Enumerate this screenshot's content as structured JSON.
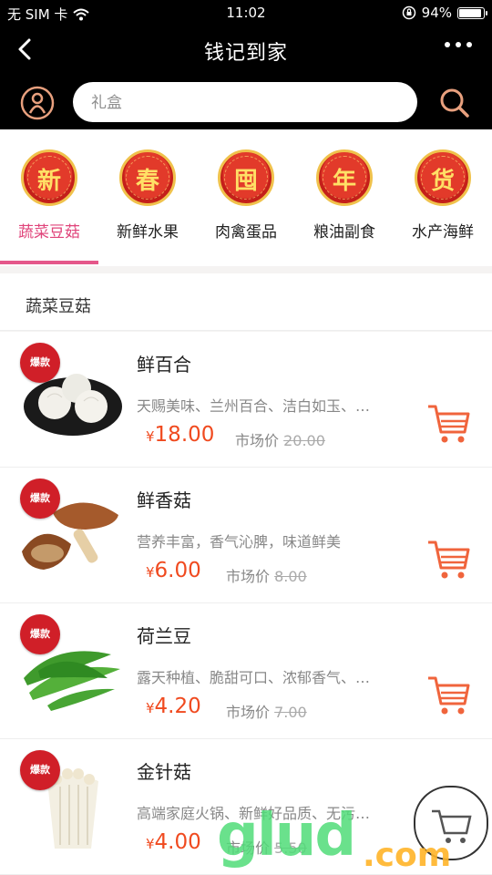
{
  "status": {
    "carrier": "无 SIM 卡",
    "time": "11:02",
    "battery": "94%",
    "battery_level": 0.94
  },
  "nav": {
    "title": "钱记到家"
  },
  "search": {
    "placeholder": "礼盒"
  },
  "categories": [
    {
      "badge": "新",
      "label": "蔬菜豆菇"
    },
    {
      "badge": "春",
      "label": "新鲜水果"
    },
    {
      "badge": "囤",
      "label": "肉禽蛋品"
    },
    {
      "badge": "年",
      "label": "粮油副食"
    },
    {
      "badge": "货",
      "label": "水产海鲜"
    }
  ],
  "section": {
    "title": "蔬菜豆菇"
  },
  "products": [
    {
      "tag": "爆款",
      "name": "鲜百合",
      "desc": "天赐美味、兰州百合、洁白如玉、…",
      "yen": "¥",
      "price": "18.00",
      "market_label": "市场价",
      "market_price": "20.00"
    },
    {
      "tag": "爆款",
      "name": "鲜香菇",
      "desc": "营养丰富，香气沁脾，味道鲜美",
      "yen": "¥",
      "price": "6.00",
      "market_label": "市场价",
      "market_price": "8.00"
    },
    {
      "tag": "爆款",
      "name": "荷兰豆",
      "desc": "露天种植、脆甜可口、浓郁香气、…",
      "yen": "¥",
      "price": "4.20",
      "market_label": "市场价",
      "market_price": "7.00"
    },
    {
      "tag": "爆款",
      "name": "金针菇",
      "desc": "高端家庭火锅、新鲜好品质、无污…",
      "yen": "¥",
      "price": "4.00",
      "market_label": "市场价",
      "market_price": "5.50"
    }
  ],
  "watermark": {
    "main": "glud",
    "suffix": ".com"
  },
  "colors": {
    "accent": "#e5578a",
    "price": "#f04a1f",
    "cart": "#f0643c",
    "topbar": "#000000"
  }
}
